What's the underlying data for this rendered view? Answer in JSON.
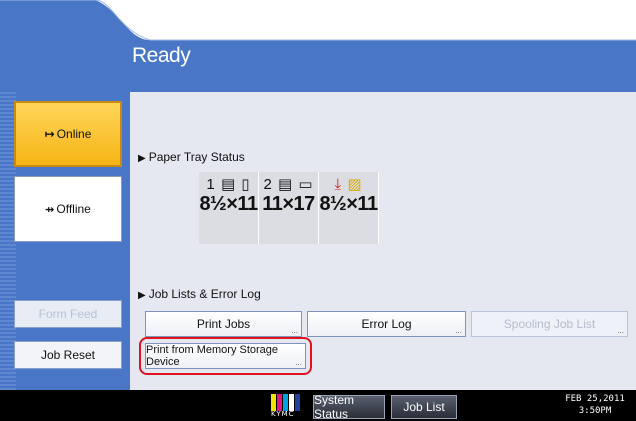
{
  "header": {
    "status": "Ready"
  },
  "left_panel": {
    "online_label": "Online",
    "offline_label": "Offline",
    "form_feed_label": "Form Feed",
    "job_reset_label": "Job Reset"
  },
  "paper_tray": {
    "section_label": "Paper Tray Status",
    "trays": [
      {
        "number": "1",
        "size": "8½×11"
      },
      {
        "number": "2",
        "size": "11×17"
      },
      {
        "number": "",
        "size": "8½×11"
      }
    ]
  },
  "jobs": {
    "section_label": "Job Lists & Error Log",
    "print_jobs_label": "Print Jobs",
    "error_log_label": "Error Log",
    "spooling_label": "Spooling Job List",
    "memory_device_label": "Print from Memory Storage Device"
  },
  "bottom_bar": {
    "system_status_label": "System Status",
    "job_list_label": "Job List",
    "date": "FEB  25,2011",
    "time": "3:50PM",
    "kymc_label": "KYMC"
  },
  "colors": {
    "accent_blue": "#4a76c7",
    "online_yellow": "#f6b516",
    "highlight_red": "#e0121e"
  }
}
